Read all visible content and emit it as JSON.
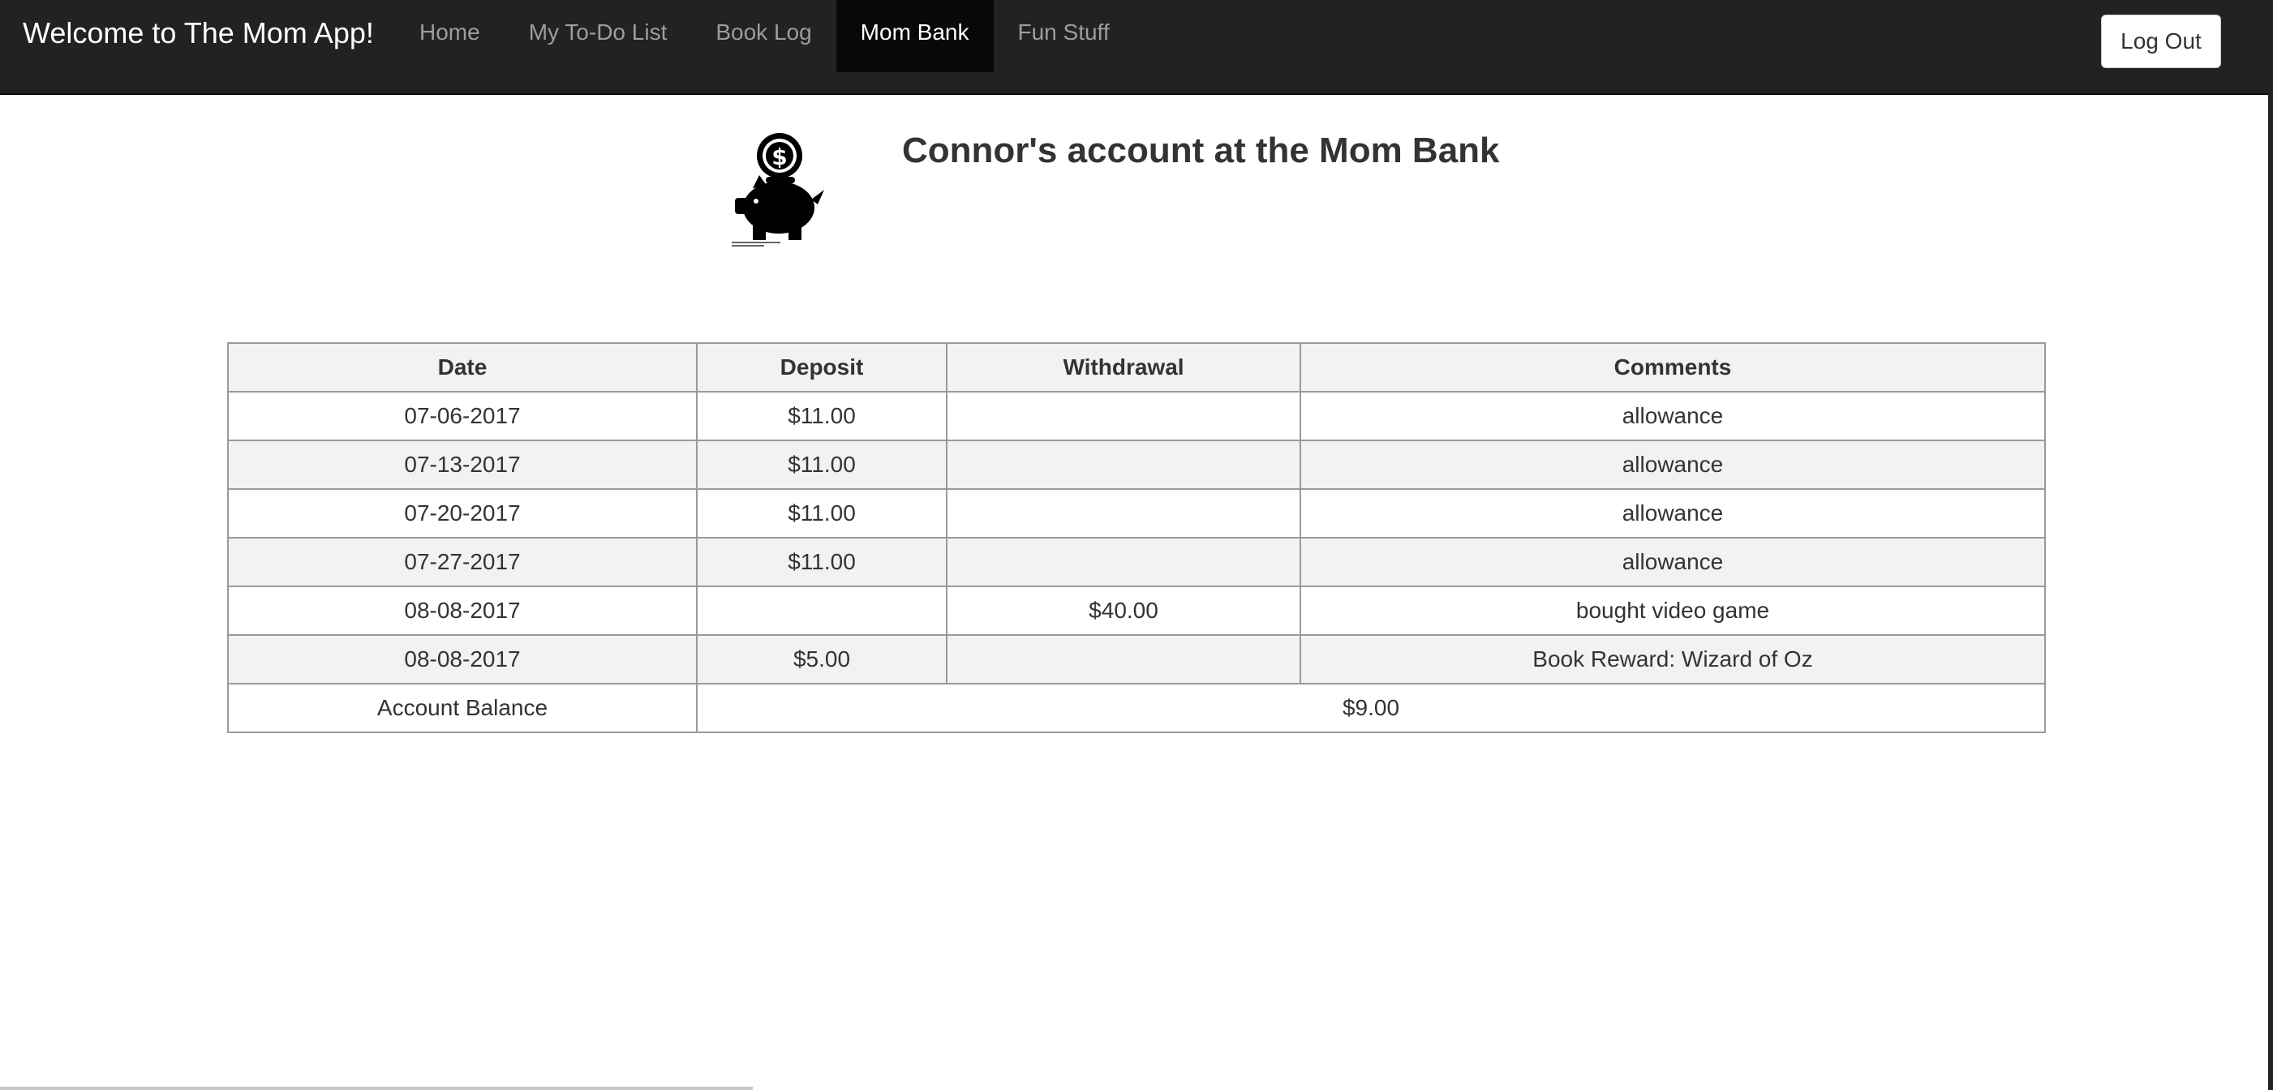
{
  "navbar": {
    "brand": "Welcome to The Mom App!",
    "items": [
      {
        "label": "Home",
        "active": false
      },
      {
        "label": "My To-Do List",
        "active": false
      },
      {
        "label": "Book Log",
        "active": false
      },
      {
        "label": "Mom Bank",
        "active": true
      },
      {
        "label": "Fun Stuff",
        "active": false
      }
    ],
    "logout_label": "Log Out",
    "background_color": "#222222",
    "active_color": "#080808"
  },
  "page": {
    "title": "Connor's account at the Mom Bank",
    "logo_icon": "piggy-bank-icon"
  },
  "ledger": {
    "columns": [
      "Date",
      "Deposit",
      "Withdrawal",
      "Comments"
    ],
    "rows": [
      {
        "date": "07-06-2017",
        "deposit": "$11.00",
        "withdrawal": "",
        "comment": "allowance"
      },
      {
        "date": "07-13-2017",
        "deposit": "$11.00",
        "withdrawal": "",
        "comment": "allowance"
      },
      {
        "date": "07-20-2017",
        "deposit": "$11.00",
        "withdrawal": "",
        "comment": "allowance"
      },
      {
        "date": "07-27-2017",
        "deposit": "$11.00",
        "withdrawal": "",
        "comment": "allowance"
      },
      {
        "date": "08-08-2017",
        "deposit": "",
        "withdrawal": "$40.00",
        "comment": "bought video game"
      },
      {
        "date": "08-08-2017",
        "deposit": "$5.00",
        "withdrawal": "",
        "comment": "Book Reward: Wizard of Oz"
      }
    ],
    "balance_label": "Account Balance",
    "balance_value": "$9.00"
  }
}
